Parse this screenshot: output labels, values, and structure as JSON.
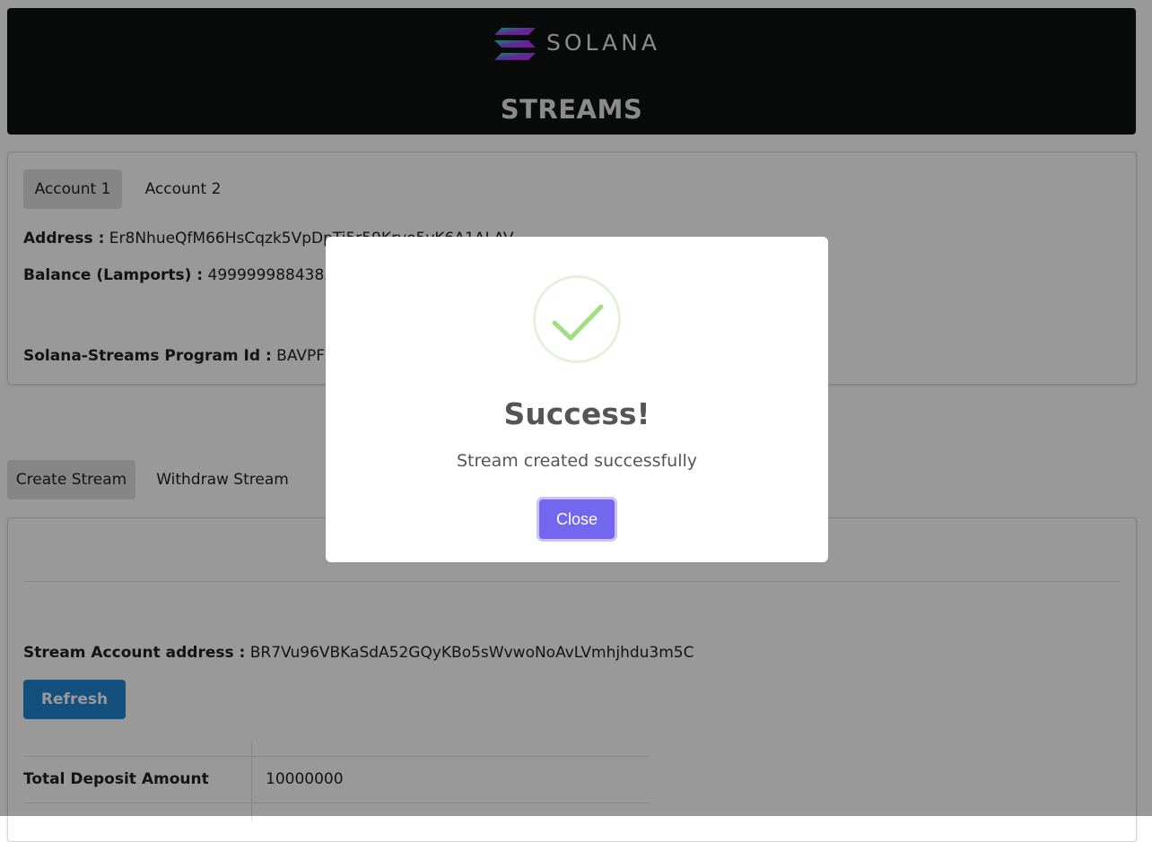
{
  "header": {
    "logo_text": "SOLANA",
    "title": "STREAMS"
  },
  "accounts": {
    "tabs": [
      {
        "label": "Account 1",
        "active": true
      },
      {
        "label": "Account 2",
        "active": false
      }
    ],
    "address_label": "Address :",
    "address_value": "Er8NhueQfM66HsCqzk5VpDpTi5r59Krvo5vK6A1ALAV",
    "balance_label": "Balance (Lamports) :",
    "balance_value": "49999998843852186",
    "program_label": "Solana-Streams Program Id :",
    "program_value": "BAVPFZCBjGv"
  },
  "stream": {
    "tabs": [
      {
        "label": "Create Stream",
        "active": true
      },
      {
        "label": "Withdraw Stream",
        "active": false
      }
    ],
    "account_label": "Stream Account address :",
    "account_value": "BR7Vu96VBKaSdA52GQyKBo5sWvwoNoAvLVmhjhdu3m5C",
    "refresh_label": "Refresh",
    "table": [
      {
        "label": "Total Deposit Amount",
        "value": "10000000"
      }
    ]
  },
  "modal": {
    "icon": "success-check-icon",
    "title": "Success!",
    "message": "Stream created successfully",
    "close_label": "Close"
  },
  "colors": {
    "header_bg": "#101111",
    "refresh_button": "#2185d0",
    "close_button": "#7367f0",
    "success_check": "#a5dc86"
  }
}
